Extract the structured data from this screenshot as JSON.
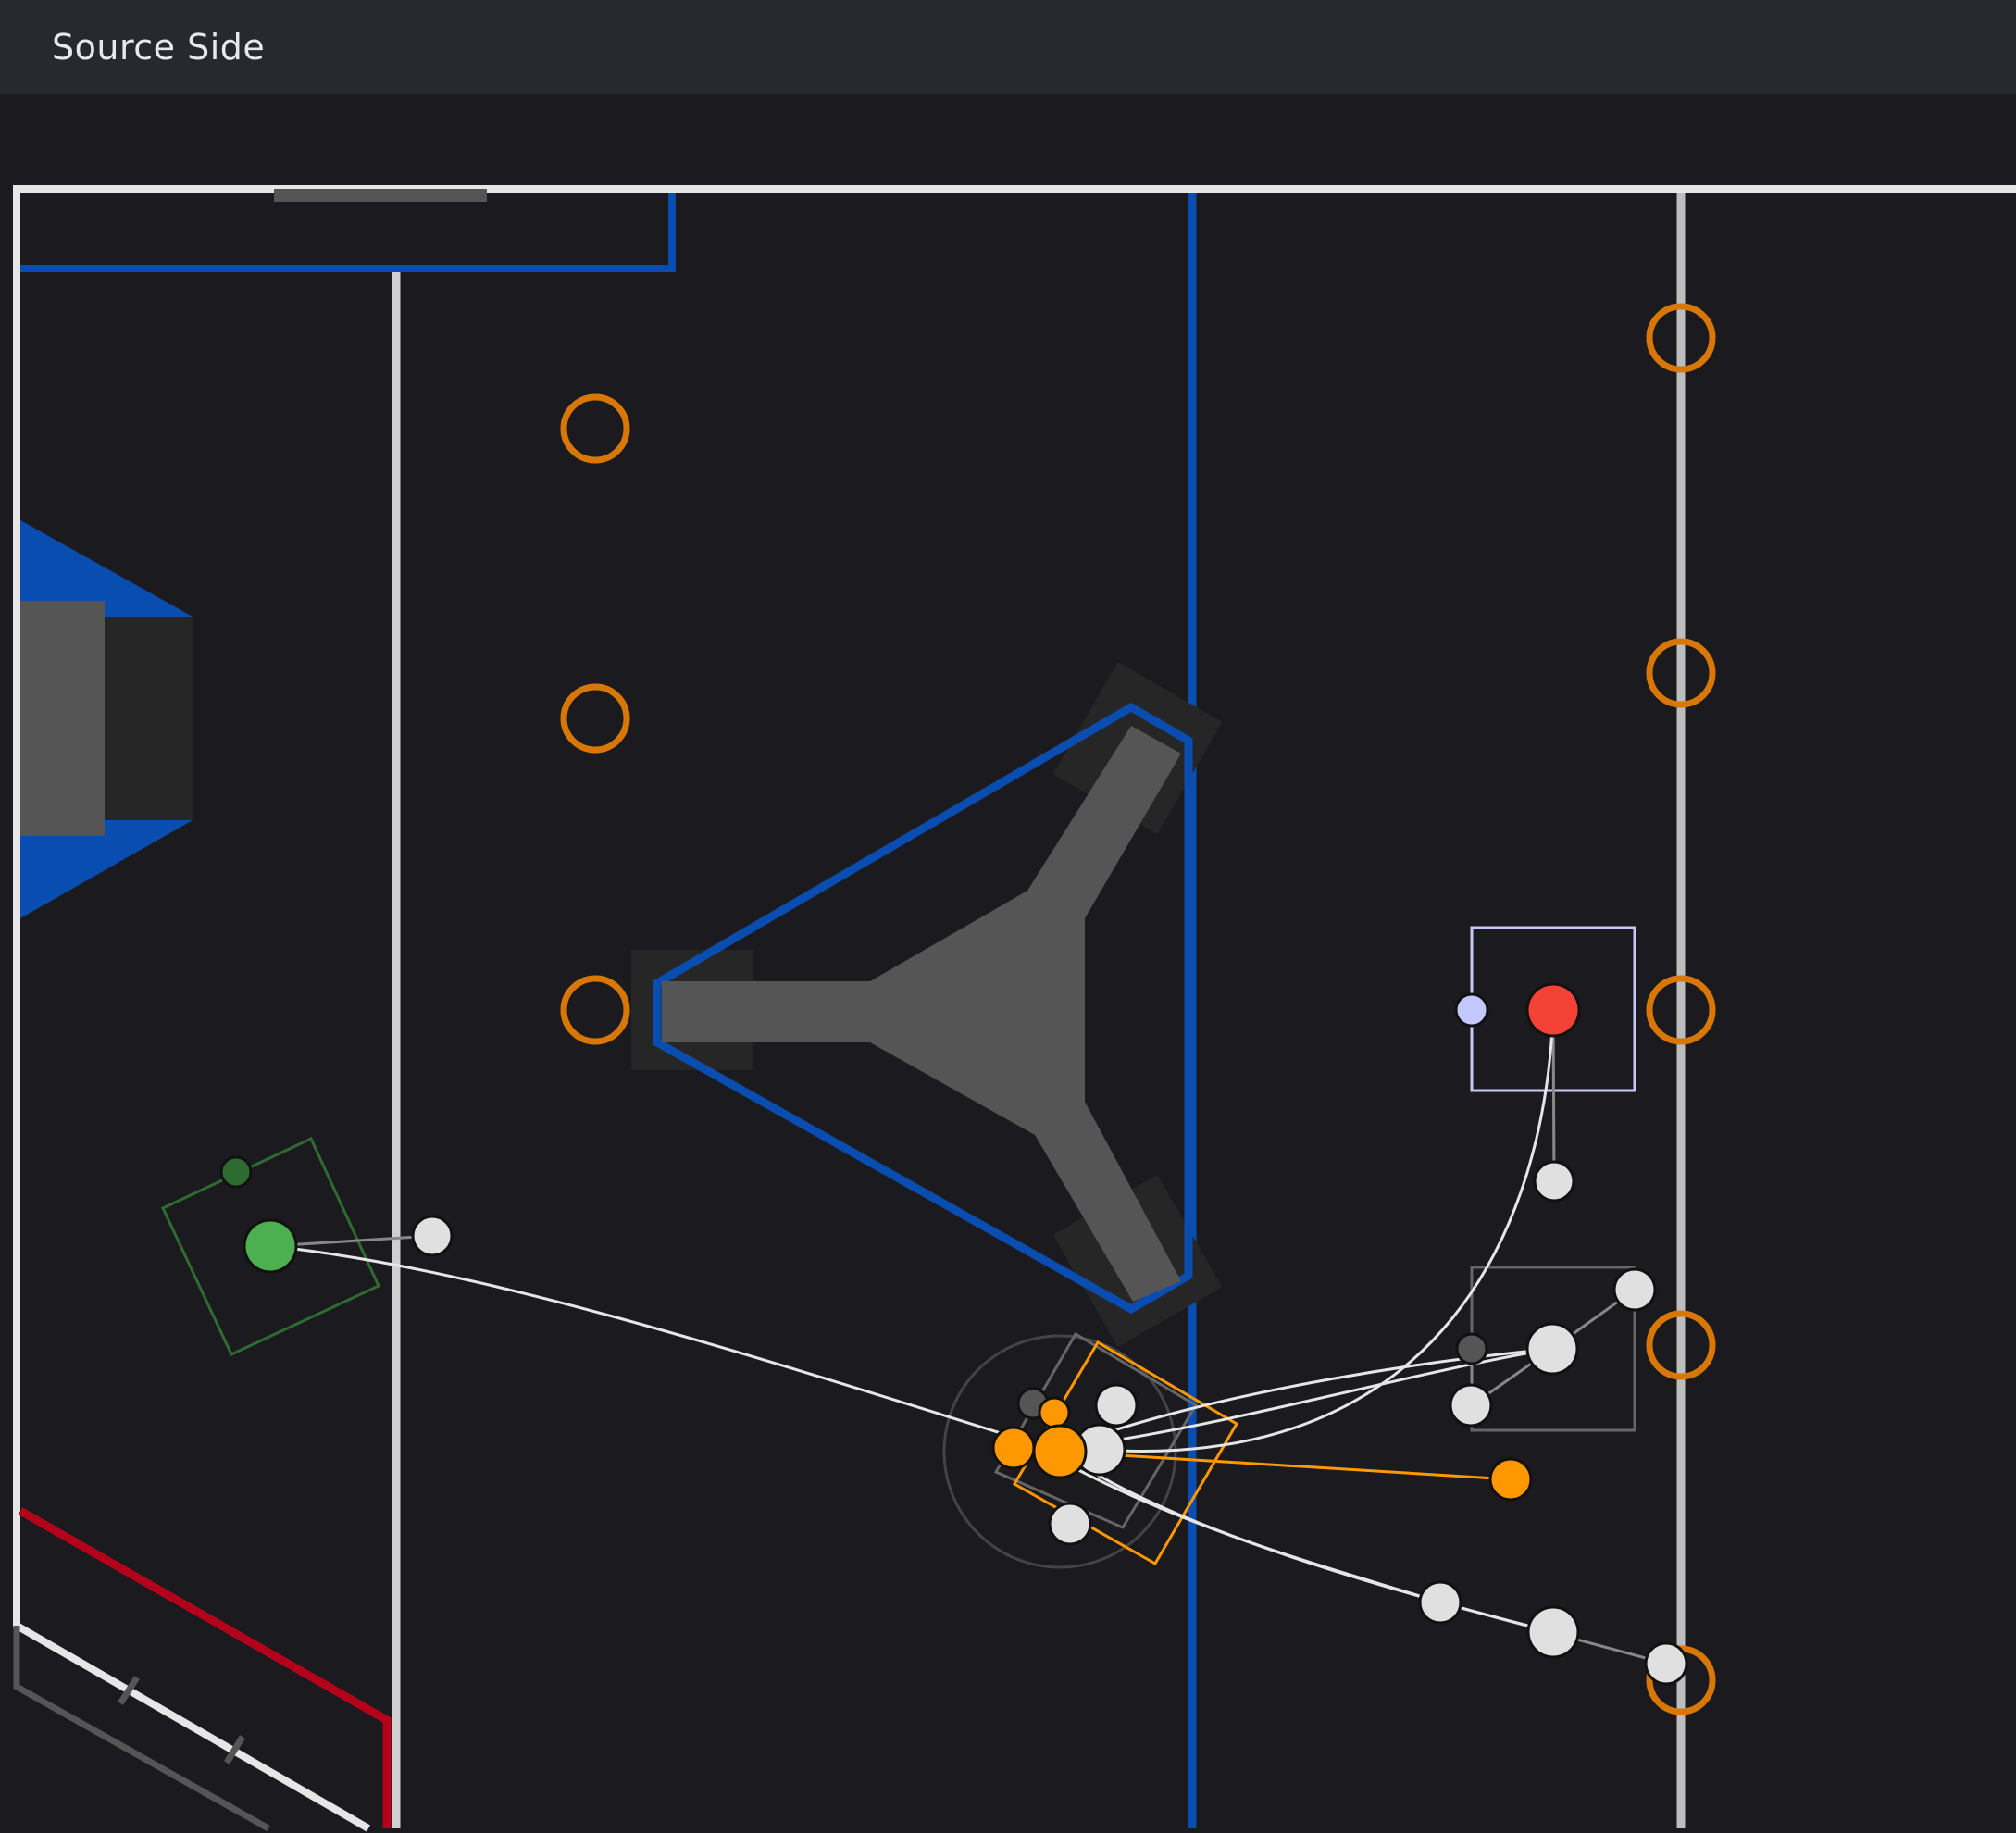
{
  "header": {
    "title": "Source Side"
  },
  "colors": {
    "background": "#1b1b1f",
    "titlebar": "#272830",
    "field_border": "#e6e6e6",
    "alliance_blue": "#0a4db0",
    "alliance_red": "#b3001b",
    "note_ring": "#d97706",
    "structure_gray": "#555555",
    "path_line": "#e6e6e6",
    "selected_path": "#ff9800",
    "start_point": "#4caf50",
    "end_point": "#f44336",
    "waypoint": "#e0e0e0"
  },
  "field": {
    "note_rings": 8,
    "waypoints": 14,
    "robot_markers": [
      "start-robot-marker",
      "selected-robot-marker",
      "end-robot-marker",
      "mid-robot-marker"
    ]
  }
}
